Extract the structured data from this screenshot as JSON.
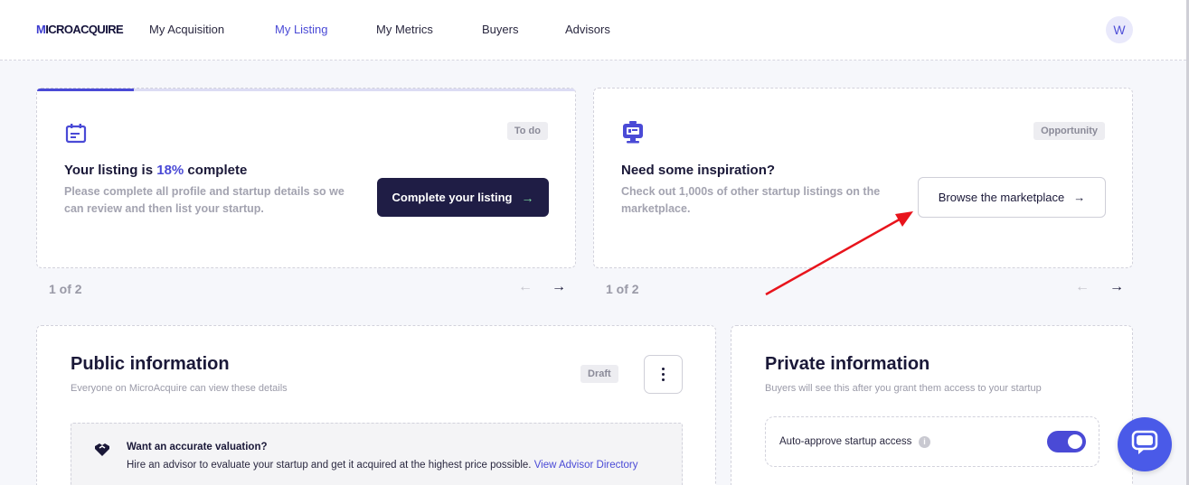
{
  "app": {
    "logo_text": "MICROACQUIRE"
  },
  "nav": {
    "items": [
      {
        "label": "My Acquisition",
        "active": false
      },
      {
        "label": "My Listing",
        "active": true
      },
      {
        "label": "My Metrics",
        "active": false
      },
      {
        "label": "Buyers",
        "active": false
      },
      {
        "label": "Advisors",
        "active": false
      }
    ],
    "avatar_initial": "W"
  },
  "cards": {
    "listing": {
      "tag": "To do",
      "icon": "calendar-icon",
      "title_prefix": "Your listing is ",
      "title_percent": "18%",
      "title_suffix": " complete",
      "progress": 0.18,
      "description": "Please complete all profile and startup details so we can review and then list your startup.",
      "button_label": "Complete your listing",
      "button_arrow": "→",
      "pager": "1 of 2"
    },
    "inspiration": {
      "tag": "Opportunity",
      "icon": "monitor-icon",
      "title": "Need some inspiration?",
      "description": "Check out 1,000s of other startup listings on the marketplace.",
      "button_label": "Browse the marketplace",
      "button_arrow": "→",
      "pager": "1 of 2"
    }
  },
  "pager_arrows": {
    "prev": "←",
    "next": "→"
  },
  "public_info": {
    "title": "Public information",
    "subtitle": "Everyone on MicroAcquire can view these details",
    "tag": "Draft",
    "valuation": {
      "title": "Want an accurate valuation?",
      "text": "Hire an advisor to evaluate your startup and get it acquired at the highest price possible. ",
      "link": "View Advisor Directory"
    }
  },
  "private_info": {
    "title": "Private information",
    "subtitle": "Buyers will see this after you grant them access to your startup",
    "toggle_label": "Auto-approve startup access",
    "toggle_on": true
  },
  "colors": {
    "accent": "#4a4ad6",
    "dark_button": "#1f1d45",
    "annotation_arrow": "#e8141c",
    "chat_fab": "#4a5ae8"
  }
}
